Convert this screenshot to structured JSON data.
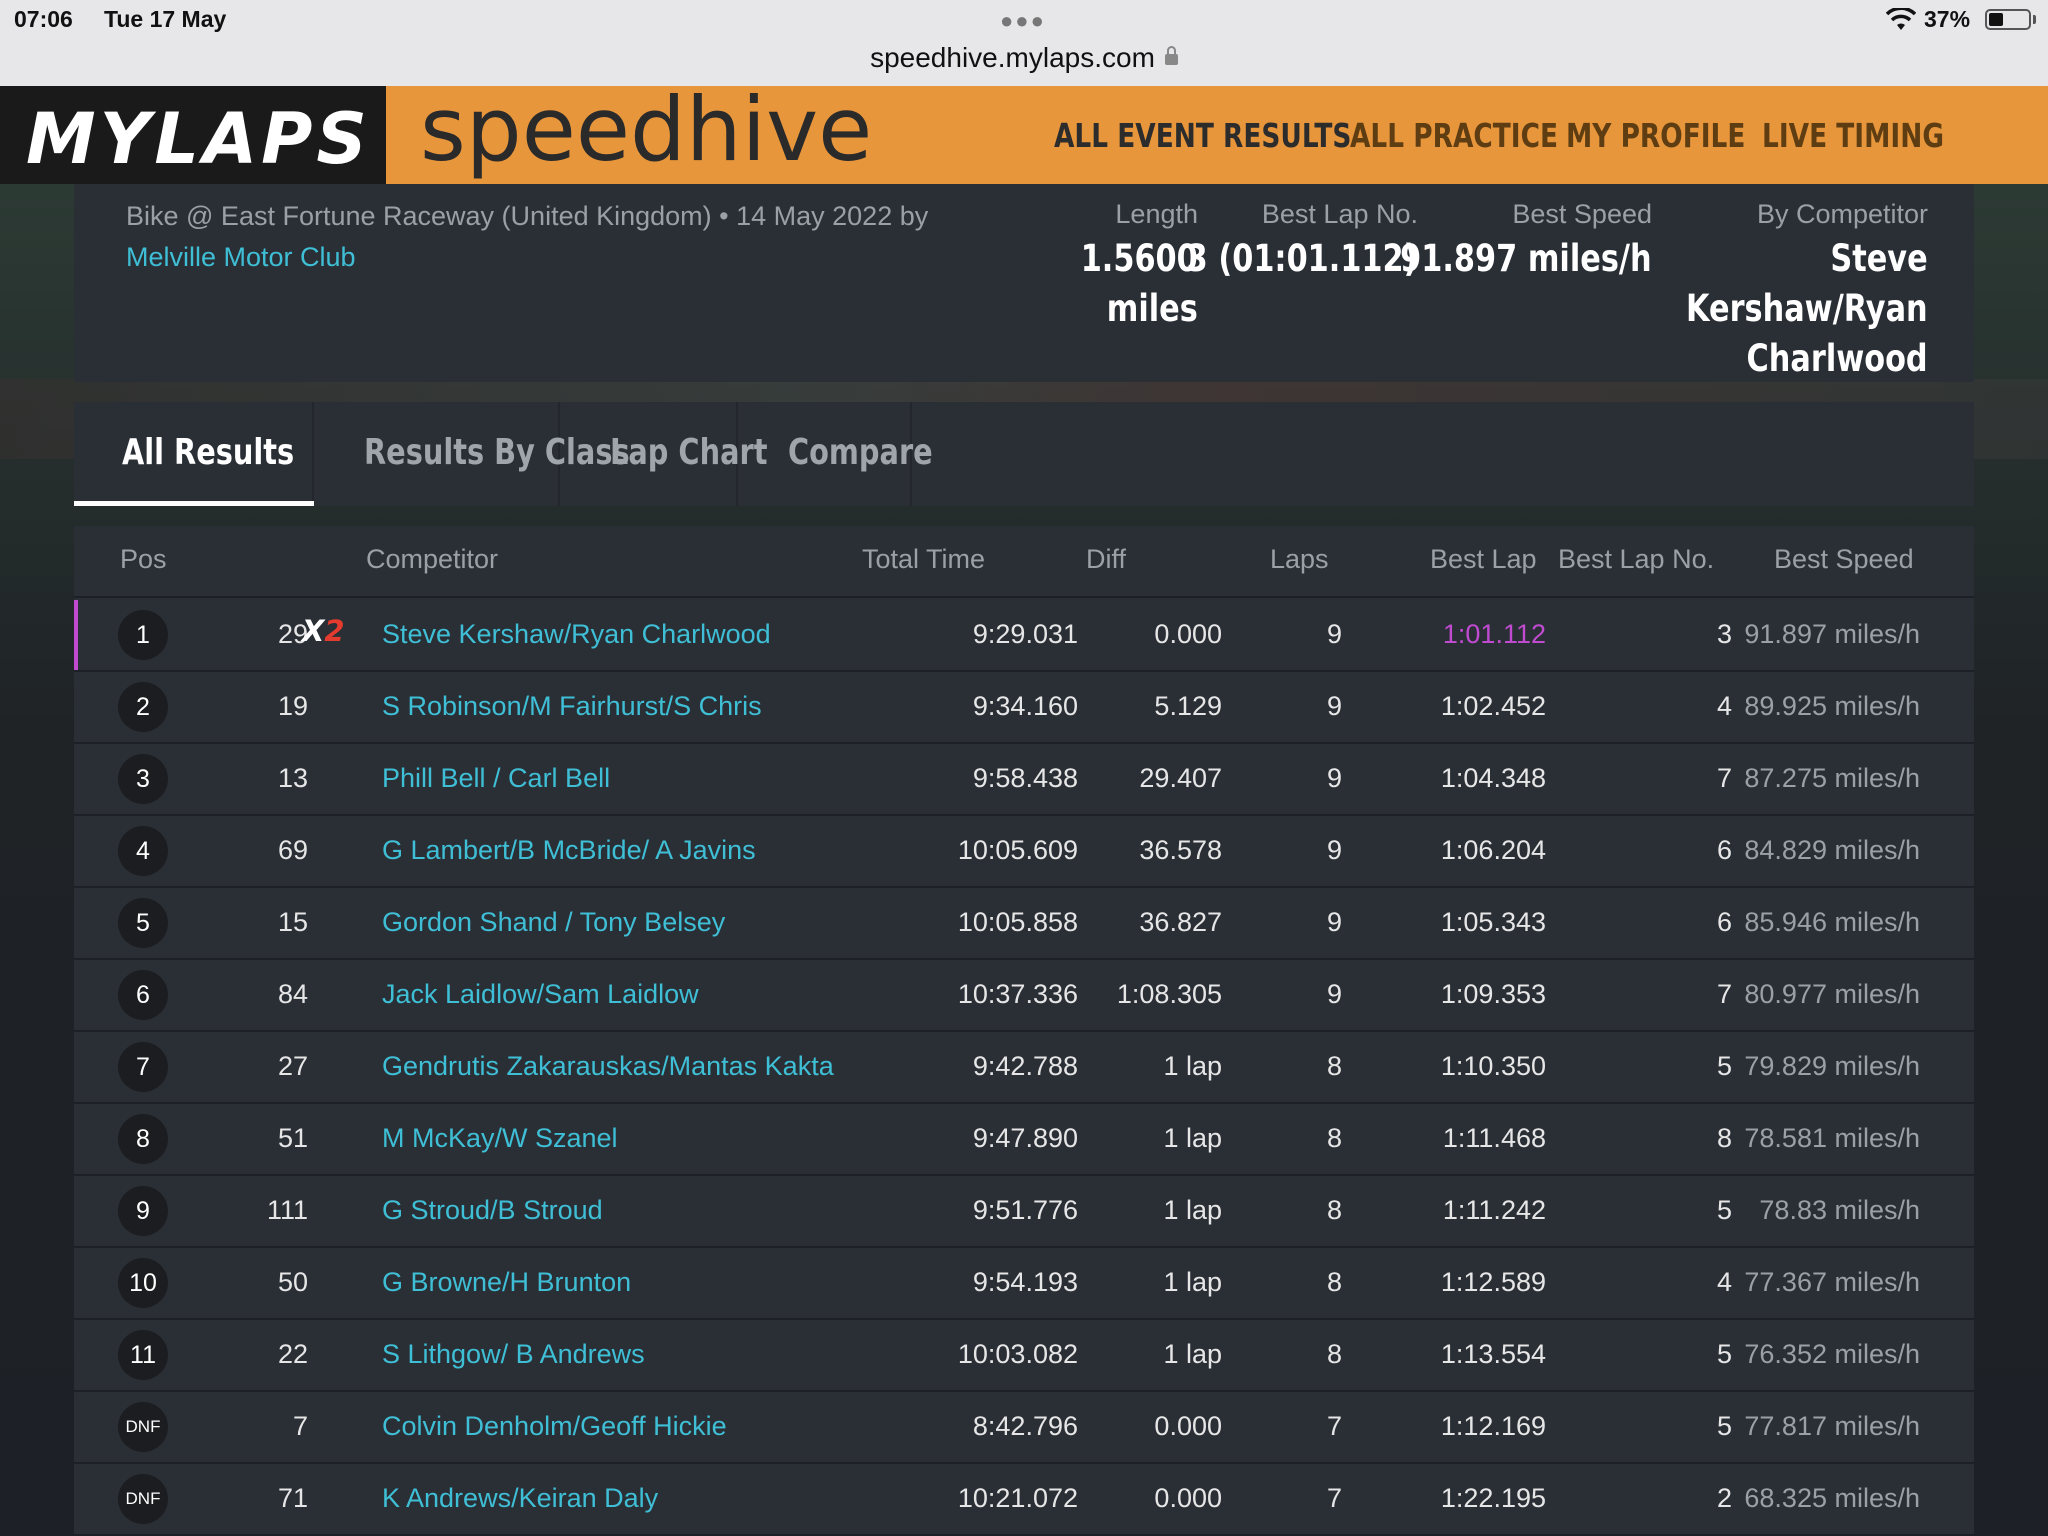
{
  "status_bar": {
    "time": "07:06",
    "date": "Tue 17 May",
    "url": "speedhive.mylaps.com",
    "battery": "37%"
  },
  "header": {
    "brand": "MYLAPS",
    "product": "speedhive",
    "nav": [
      "ALL EVENT RESULTS",
      "ALL PRACTICE",
      "MY PROFILE",
      "LIVE TIMING"
    ]
  },
  "event": {
    "subtitle": "Bike @ East Fortune Raceway (United Kingdom) • 14 May 2022 by",
    "club": "Melville Motor Club",
    "metrics": [
      {
        "label": "Length",
        "value_lines": [
          "1.5600",
          "miles"
        ]
      },
      {
        "label": "Best Lap No.",
        "value_lines": [
          "3 (01:01.112)"
        ]
      },
      {
        "label": "Best Speed",
        "value_lines": [
          "91.897 miles/h"
        ]
      },
      {
        "label": "By Competitor",
        "value_lines": [
          "Steve",
          "Kershaw/Ryan",
          "Charlwood"
        ]
      }
    ]
  },
  "tabs": [
    "All Results",
    "Results By Class",
    "Lap Chart",
    "Compare"
  ],
  "table": {
    "headers": {
      "pos": "Pos",
      "competitor": "Competitor",
      "total_time": "Total Time",
      "diff": "Diff",
      "laps": "Laps",
      "best_lap": "Best Lap",
      "best_lap_no": "Best Lap No.",
      "best_speed": "Best Speed"
    },
    "badge": {
      "x": "X",
      "n": "2"
    },
    "rows": [
      {
        "pos": "1",
        "num": "29",
        "competitor": "Steve Kershaw/Ryan Charlwood",
        "total": "9:29.031",
        "diff": "0.000",
        "laps": "9",
        "best_lap": "1:01.112",
        "best_lap_no": "3",
        "speed": "91.897 miles/h"
      },
      {
        "pos": "2",
        "num": "19",
        "competitor": "S Robinson/M Fairhurst/S Chris",
        "total": "9:34.160",
        "diff": "5.129",
        "laps": "9",
        "best_lap": "1:02.452",
        "best_lap_no": "4",
        "speed": "89.925 miles/h"
      },
      {
        "pos": "3",
        "num": "13",
        "competitor": "Phill Bell / Carl Bell",
        "total": "9:58.438",
        "diff": "29.407",
        "laps": "9",
        "best_lap": "1:04.348",
        "best_lap_no": "7",
        "speed": "87.275 miles/h"
      },
      {
        "pos": "4",
        "num": "69",
        "competitor": "G Lambert/B McBride/ A Javins",
        "total": "10:05.609",
        "diff": "36.578",
        "laps": "9",
        "best_lap": "1:06.204",
        "best_lap_no": "6",
        "speed": "84.829 miles/h"
      },
      {
        "pos": "5",
        "num": "15",
        "competitor": "Gordon Shand / Tony Belsey",
        "total": "10:05.858",
        "diff": "36.827",
        "laps": "9",
        "best_lap": "1:05.343",
        "best_lap_no": "6",
        "speed": "85.946 miles/h"
      },
      {
        "pos": "6",
        "num": "84",
        "competitor": "Jack Laidlow/Sam Laidlow",
        "total": "10:37.336",
        "diff": "1:08.305",
        "laps": "9",
        "best_lap": "1:09.353",
        "best_lap_no": "7",
        "speed": "80.977 miles/h"
      },
      {
        "pos": "7",
        "num": "27",
        "competitor": "Gendrutis Zakarauskas/Mantas Kakta",
        "total": "9:42.788",
        "diff": "1 lap",
        "laps": "8",
        "best_lap": "1:10.350",
        "best_lap_no": "5",
        "speed": "79.829 miles/h"
      },
      {
        "pos": "8",
        "num": "51",
        "competitor": "M McKay/W Szanel",
        "total": "9:47.890",
        "diff": "1 lap",
        "laps": "8",
        "best_lap": "1:11.468",
        "best_lap_no": "8",
        "speed": "78.581 miles/h"
      },
      {
        "pos": "9",
        "num": "111",
        "competitor": "G Stroud/B Stroud",
        "total": "9:51.776",
        "diff": "1 lap",
        "laps": "8",
        "best_lap": "1:11.242",
        "best_lap_no": "5",
        "speed": "78.83 miles/h"
      },
      {
        "pos": "10",
        "num": "50",
        "competitor": "G Browne/H Brunton",
        "total": "9:54.193",
        "diff": "1 lap",
        "laps": "8",
        "best_lap": "1:12.589",
        "best_lap_no": "4",
        "speed": "77.367 miles/h"
      },
      {
        "pos": "11",
        "num": "22",
        "competitor": "S Lithgow/ B Andrews",
        "total": "10:03.082",
        "diff": "1 lap",
        "laps": "8",
        "best_lap": "1:13.554",
        "best_lap_no": "5",
        "speed": "76.352 miles/h"
      },
      {
        "pos": "DNF",
        "num": "7",
        "competitor": "Colvin Denholm/Geoff Hickie",
        "total": "8:42.796",
        "diff": "0.000",
        "laps": "7",
        "best_lap": "1:12.169",
        "best_lap_no": "5",
        "speed": "77.817 miles/h"
      },
      {
        "pos": "DNF",
        "num": "71",
        "competitor": "K Andrews/Keiran Daly",
        "total": "10:21.072",
        "diff": "0.000",
        "laps": "7",
        "best_lap": "1:22.195",
        "best_lap_no": "2",
        "speed": "68.325 miles/h"
      }
    ]
  },
  "colors": {
    "header_orange": "#e8963c",
    "link_teal": "#3fbfd6",
    "best_lap_purple": "#c04bd0",
    "panel": "#2a2f36"
  }
}
